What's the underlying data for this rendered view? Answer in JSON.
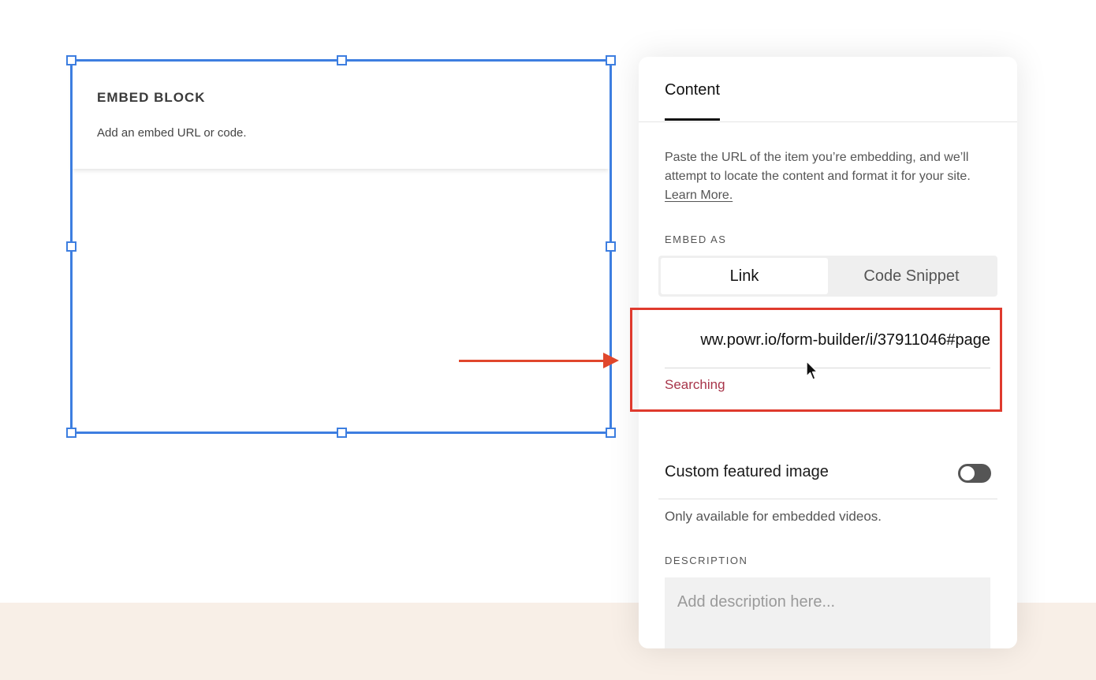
{
  "embed_block": {
    "title": "EMBED BLOCK",
    "description": "Add an embed URL or code."
  },
  "panel": {
    "tab_label": "Content",
    "intro_text": "Paste the URL of the item you’re embedding, and we’ll attempt to locate the content and format it for your site. ",
    "learn_more": "Learn More.",
    "embed_as_label": "EMBED AS",
    "embed_as_options": [
      "Link",
      "Code Snippet"
    ],
    "embed_as_selected": "Link",
    "url_value": "ww.powr.io/form-builder/i/37911046#page",
    "status_text": "Searching",
    "custom_image_label": "Custom featured image",
    "custom_image_enabled": false,
    "custom_image_help": "Only available for embedded videos.",
    "description_label": "DESCRIPTION",
    "description_placeholder": "Add description here..."
  },
  "colors": {
    "selection": "#3d7ee0",
    "annotation": "#df3a2d",
    "status": "#a8354a",
    "footer_bg": "#f8efe7"
  }
}
